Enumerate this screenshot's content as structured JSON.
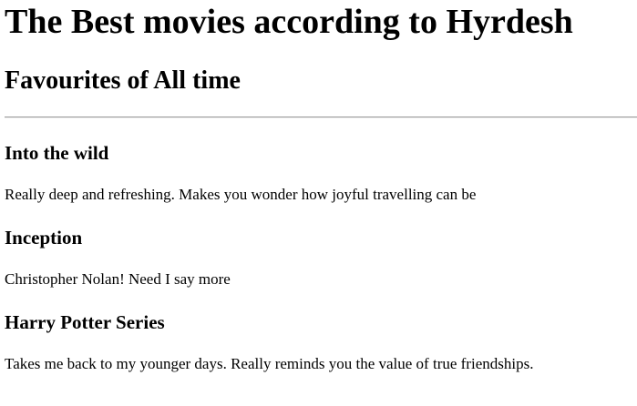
{
  "page": {
    "title": "The Best movies according to Hyrdesh",
    "subtitle": "Favourites of All time"
  },
  "movies": [
    {
      "title": "Into the wild",
      "description": "Really deep and refreshing. Makes you wonder how joyful travelling can be"
    },
    {
      "title": "Inception",
      "description": "Christopher Nolan! Need I say more"
    },
    {
      "title": "Harry Potter Series",
      "description": "Takes me back to my younger days. Really reminds you the value of true friendships."
    }
  ]
}
